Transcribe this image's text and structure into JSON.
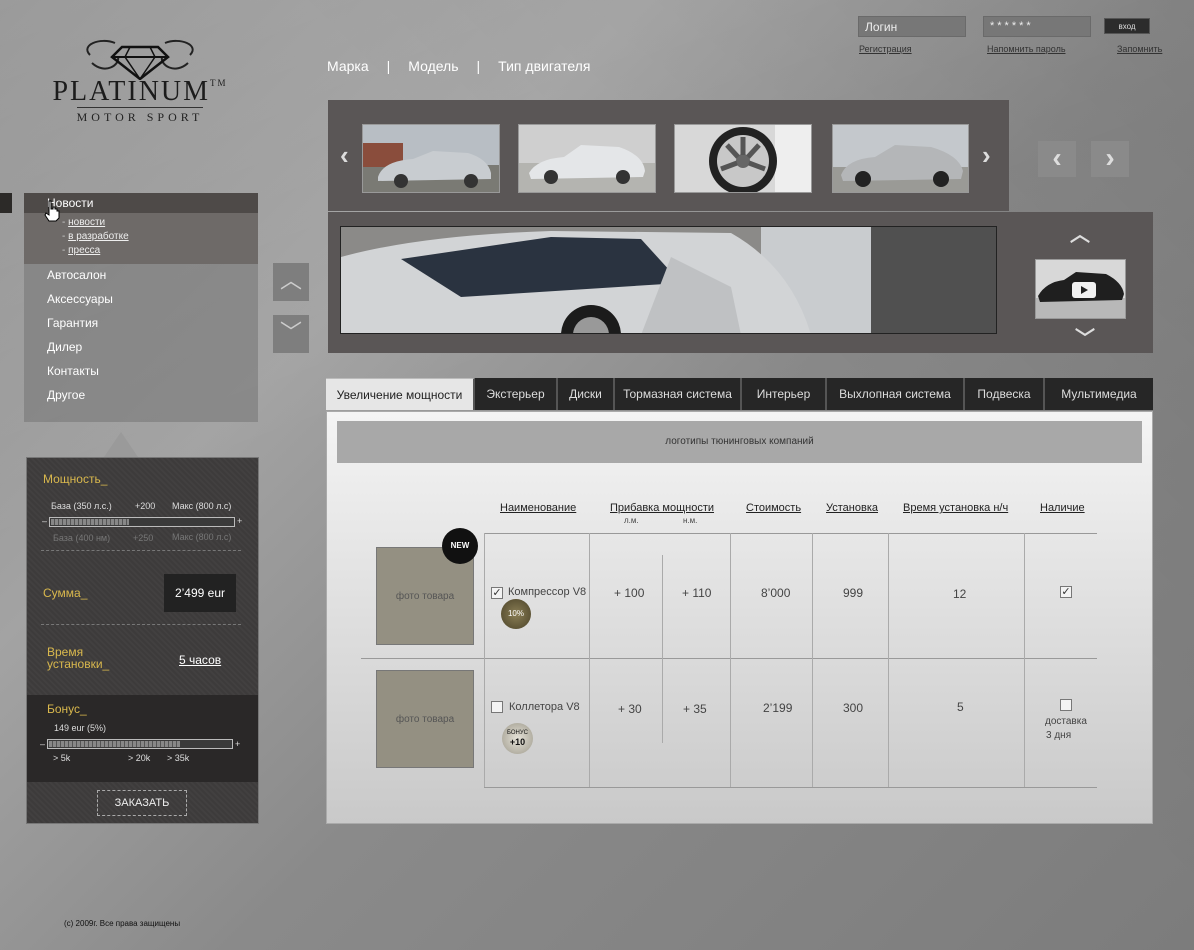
{
  "brand": {
    "name": "PLATINUM",
    "tm": "TM",
    "sub": "MOTOR SPORT"
  },
  "login": {
    "login_placeholder": "Логин",
    "password_mask": "******",
    "submit": "вход",
    "register": "Регистрация",
    "forgot": "Напомнить пароль",
    "remember": "Запомнить"
  },
  "topnav": [
    "Марка",
    "Модель",
    "Тип двигателя"
  ],
  "topnav_sep": "|",
  "menu": {
    "active": "Новости",
    "sub": [
      "новости",
      "в разработке",
      "пресса"
    ],
    "sub_prefix": "-",
    "items": [
      "Автосалон",
      "Аксессуары",
      "Гарантия",
      "Дилер",
      "Контакты",
      "Другое"
    ]
  },
  "calc": {
    "power_label": "Мощность_",
    "base_top": "База (350 л.с.)",
    "plus_top": "+200",
    "max_top": "Макс (800 л.с)",
    "base_bottom": "База (400 нм)",
    "plus_bottom": "+250",
    "max_bottom": "Макс (800 л.с)",
    "minus": "–",
    "plus": "+",
    "power_level": 0.43,
    "sum_label": "Сумма_",
    "sum_value": "2’499 eur",
    "time_label_1": "Время",
    "time_label_2": "установки_",
    "time_value": "5 часов",
    "bonus_label": "Бонус_",
    "bonus_value": "149 eur (5%)",
    "bonus_level": 0.72,
    "bonus_marks": [
      "> 5k",
      "> 20k",
      "> 35k"
    ],
    "order": "ЗАКАЗАТЬ"
  },
  "tabs": [
    "Увеличение мощности",
    "Экстерьер",
    "Диски",
    "Тормазная система",
    "Интерьер",
    "Выхлопная система",
    "Подвеска",
    "Мультимедиа"
  ],
  "active_tab": 0,
  "logos_text": "логотипы тюнинговых компаний",
  "table": {
    "headers": {
      "name": "Наименование",
      "power": "Прибавка мощности",
      "power_sub1": "л.м.",
      "power_sub2": "н.м.",
      "cost": "Стоимость",
      "install": "Установка",
      "time": "Время установка н/ч",
      "avail": "Наличие"
    },
    "photo_label": "фото товара",
    "new_badge": "NEW",
    "rows": [
      {
        "checked": true,
        "name": "Компрессор V8",
        "badge": "10%",
        "lm": "+ 100",
        "nm": "+ 110",
        "cost": "8’000",
        "install": "999",
        "time": "12",
        "avail_checked": true,
        "avail_text": ""
      },
      {
        "checked": false,
        "name": "Коллетора V8",
        "badge_top": "БОНУС",
        "badge": "+10",
        "lm": "+ 30",
        "nm": "+ 35",
        "cost": "2’199",
        "install": "300",
        "time": "5",
        "avail_checked": false,
        "avail_text_1": "доставка",
        "avail_text_2": "3 дня"
      }
    ]
  },
  "footer": "(c) 2009г. Все права защищены",
  "colors": {
    "accent": "#d9b84d",
    "panel": "#3d3b3b",
    "dark_bar": "#5a5656"
  }
}
